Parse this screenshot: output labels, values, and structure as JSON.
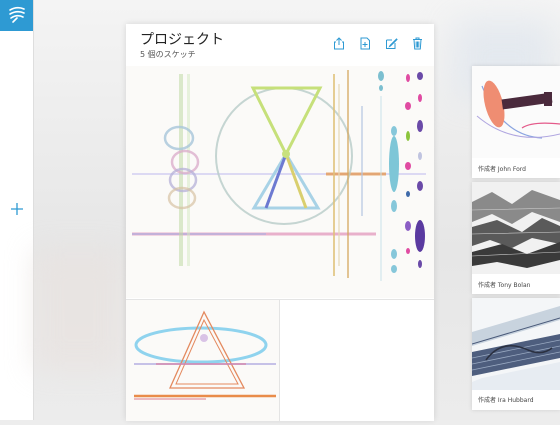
{
  "app": {
    "logo": "paper-app-logo-icon"
  },
  "rail": {
    "add_icon": "plus-icon",
    "add_symbol": "+"
  },
  "project": {
    "title": "プロジェクト",
    "subtitle": "5 個のスケッチ",
    "tools": [
      "share-icon",
      "add-page-icon",
      "edit-icon",
      "trash-icon"
    ]
  },
  "cards": [
    {
      "author": "作成者 John Ford"
    },
    {
      "author": "作成者 Tony Bolan"
    },
    {
      "author": "作成者 Ira Hubbard"
    }
  ],
  "colors": {
    "accent": "#2e9ad3"
  }
}
